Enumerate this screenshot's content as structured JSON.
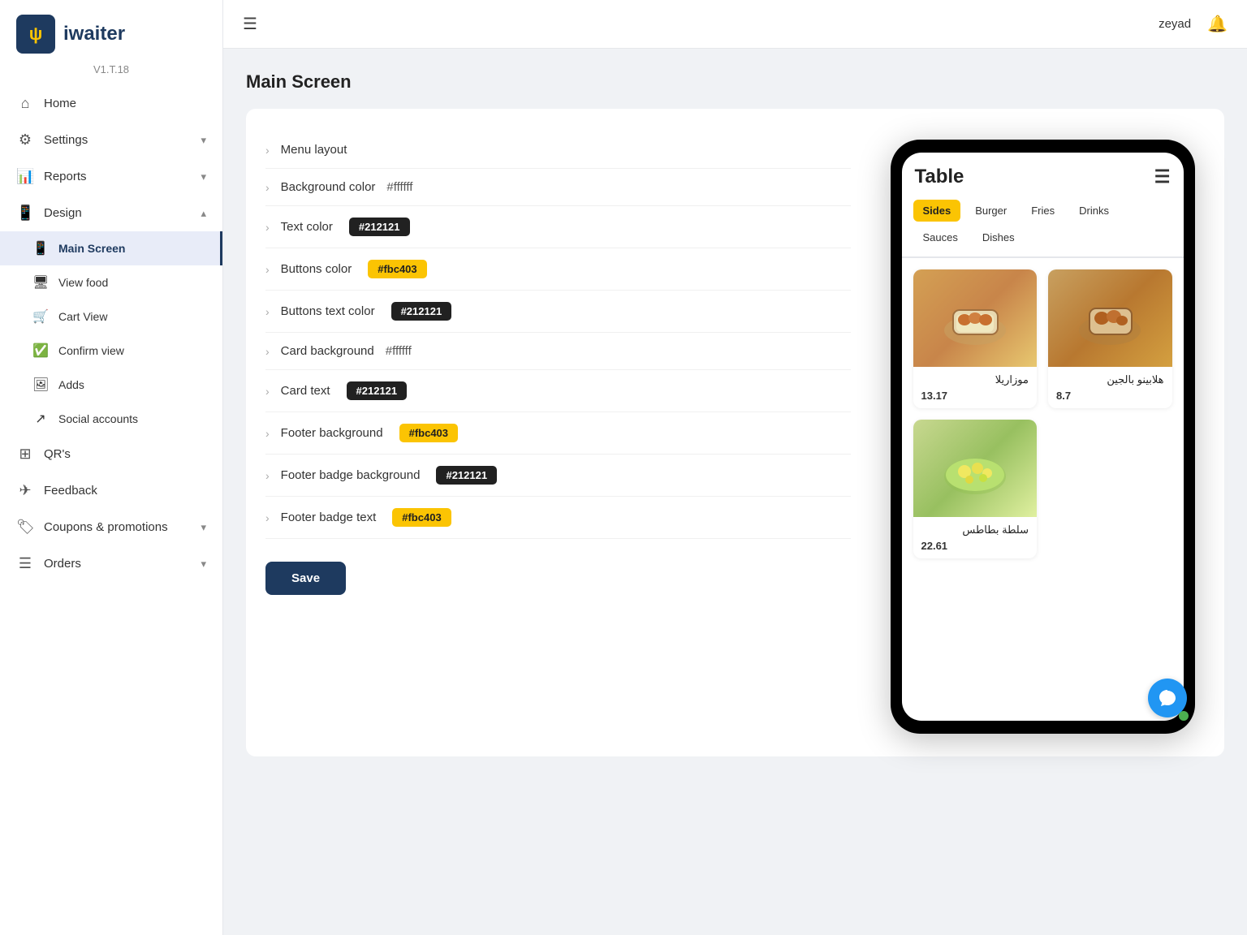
{
  "app": {
    "name": "iwaiter",
    "version": "V1.T.18",
    "logo_symbol": "ψ"
  },
  "topbar": {
    "username": "zeyad",
    "menu_icon": "☰",
    "bell_icon": "🔔"
  },
  "sidebar": {
    "nav_items": [
      {
        "id": "home",
        "label": "Home",
        "icon": "⌂",
        "has_chevron": false
      },
      {
        "id": "settings",
        "label": "Settings",
        "icon": "⚙",
        "has_chevron": true
      },
      {
        "id": "reports",
        "label": "Reports",
        "icon": "📊",
        "has_chevron": true
      },
      {
        "id": "design",
        "label": "Design",
        "icon": "📱",
        "has_chevron": true,
        "expanded": true
      }
    ],
    "design_sub_items": [
      {
        "id": "main-screen",
        "label": "Main Screen",
        "icon": "📱",
        "active": true
      },
      {
        "id": "view-food",
        "label": "View food",
        "icon": "🖥",
        "active": false
      },
      {
        "id": "cart-view",
        "label": "Cart View",
        "icon": "🛒",
        "active": false
      },
      {
        "id": "confirm-view",
        "label": "Confirm view",
        "icon": "✅",
        "active": false
      },
      {
        "id": "adds",
        "label": "Adds",
        "icon": "🖼",
        "active": false
      },
      {
        "id": "social-accounts",
        "label": "Social accounts",
        "icon": "↗",
        "active": false
      }
    ],
    "bottom_nav_items": [
      {
        "id": "qrs",
        "label": "QR's",
        "icon": "⊞",
        "has_chevron": false
      },
      {
        "id": "feedback",
        "label": "Feedback",
        "icon": "✈",
        "has_chevron": false
      },
      {
        "id": "coupons",
        "label": "Coupons & promotions",
        "icon": "🏷",
        "has_chevron": true
      },
      {
        "id": "orders",
        "label": "Orders",
        "icon": "☰",
        "has_chevron": true
      }
    ]
  },
  "page": {
    "title": "Main Screen"
  },
  "settings": {
    "rows": [
      {
        "id": "menu-layout",
        "label": "Menu layout",
        "value": "",
        "badge_type": "none"
      },
      {
        "id": "bg-color",
        "label": "Background color",
        "value": "#ffffff",
        "badge_type": "text"
      },
      {
        "id": "text-color",
        "label": "Text color",
        "value": "#212121",
        "badge_type": "dark"
      },
      {
        "id": "buttons-color",
        "label": "Buttons color",
        "value": "#fbc403",
        "badge_type": "yellow"
      },
      {
        "id": "buttons-text-color",
        "label": "Buttons text color",
        "value": "#212121",
        "badge_type": "dark"
      },
      {
        "id": "card-bg",
        "label": "Card background",
        "value": "#ffffff",
        "badge_type": "text"
      },
      {
        "id": "card-text",
        "label": "Card text",
        "value": "#212121",
        "badge_type": "dark"
      },
      {
        "id": "footer-bg",
        "label": "Footer background",
        "value": "#fbc403",
        "badge_type": "yellow"
      },
      {
        "id": "footer-badge-bg",
        "label": "Footer badge background",
        "value": "#212121",
        "badge_type": "dark"
      },
      {
        "id": "footer-badge-text",
        "label": "Footer badge text",
        "value": "#fbc403",
        "badge_type": "yellow"
      }
    ],
    "save_button": "Save"
  },
  "phone_preview": {
    "header": "Table",
    "tabs": [
      "Sides",
      "Burger",
      "Fries",
      "Drinks",
      "Sauces",
      "Dishes"
    ],
    "active_tab": "Sides",
    "food_items": [
      {
        "id": 1,
        "name": "موزاريلا",
        "price": "13.17",
        "img_type": "fried1"
      },
      {
        "id": 2,
        "name": "هلابينو بالجين",
        "price": "8.7",
        "img_type": "fried2"
      },
      {
        "id": 3,
        "name": "سلطة بطاطس",
        "price": "22.61",
        "img_type": "salad"
      }
    ]
  }
}
